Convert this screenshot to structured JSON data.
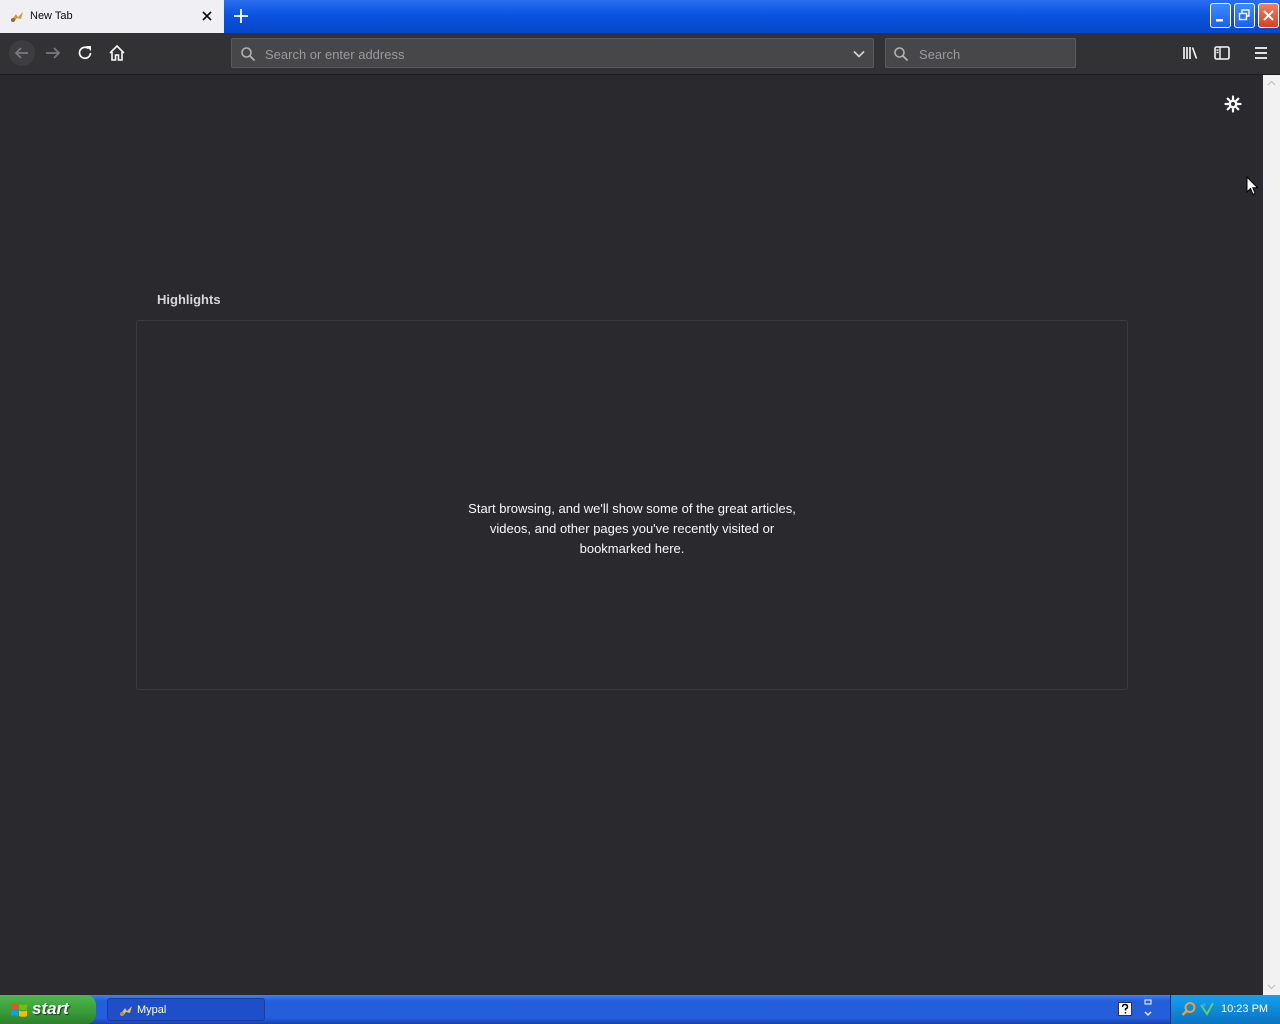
{
  "app": {
    "name": "Mypal"
  },
  "tab": {
    "title": "New Tab"
  },
  "urlbar": {
    "placeholder": "Search or enter address"
  },
  "searchbar": {
    "placeholder": "Search"
  },
  "content": {
    "highlights_title": "Highlights",
    "highlights_empty_message": "Start browsing, and we'll show some of the great articles, videos, and other pages you've recently visited or bookmarked here."
  },
  "taskbar": {
    "start_label": "start",
    "task_label": "Mypal",
    "clock": "10:23 PM"
  },
  "colors": {
    "content_bg": "#2a2a2e",
    "toolbar_bg": "#323234",
    "xp_blue": "#245edb",
    "start_green": "#389a38"
  },
  "icons": [
    "mypal-favicon-icon",
    "close-icon",
    "plus-icon",
    "minimize-icon",
    "restore-icon",
    "window-close-icon",
    "back-arrow-icon",
    "forward-arrow-icon",
    "reload-icon",
    "home-icon",
    "search-icon",
    "chevron-down-icon",
    "library-icon",
    "sidebar-icon",
    "hamburger-menu-icon",
    "gear-icon",
    "windows-logo-icon",
    "help-icon",
    "cursor-icon"
  ]
}
